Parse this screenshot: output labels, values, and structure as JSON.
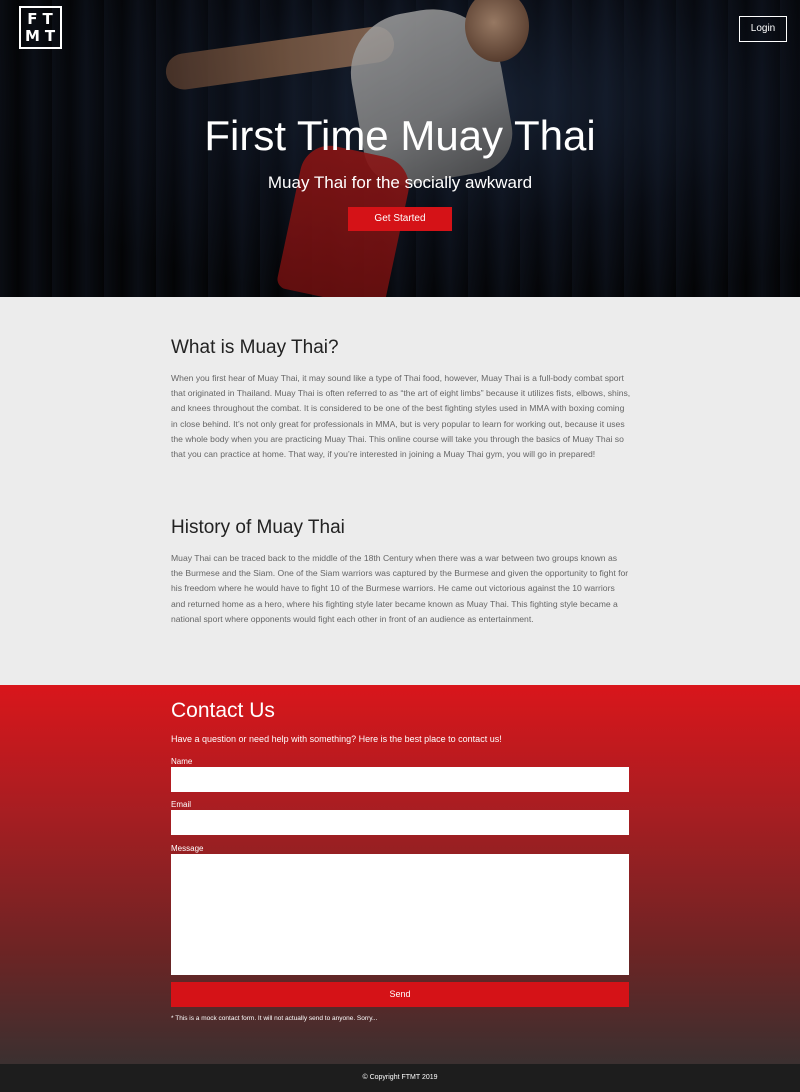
{
  "logo": {
    "line1": "FT",
    "line2": "MT"
  },
  "header": {
    "login_label": "Login"
  },
  "hero": {
    "title": "First Time Muay Thai",
    "subtitle": "Muay Thai for the socially awkward",
    "cta_label": "Get Started"
  },
  "sections": [
    {
      "title": "What is Muay Thai?",
      "body": "When you first hear of Muay Thai, it may sound like a type of Thai food, however, Muay Thai is a full-body combat sport that originated in Thailand. Muay Thai is often referred to as “the art of eight limbs” because it utilizes fists, elbows, shins, and knees throughout the combat. It is considered to be one of the best fighting styles used in MMA with boxing coming in close behind. It’s not only great for professionals in MMA, but is very popular to learn for working out, because it uses the whole body when you are practicing Muay Thai. This online course will take you through the basics of Muay Thai so that you can practice at home. That way, if you’re interested in joining a Muay Thai gym, you will go in prepared!"
    },
    {
      "title": "History of Muay Thai",
      "body": "Muay Thai can be traced back to the middle of the 18th Century when there was a war between two groups known as the Burmese and the Siam. One of the Siam warriors was captured by the Burmese and given the opportunity to fight for his freedom where he would have to fight 10 of the Burmese warriors. He came out victorious against the 10 warriors and returned home as a hero, where his fighting style later became known as Muay Thai. This fighting style became a national sport where opponents would fight each other in front of an audience as entertainment."
    }
  ],
  "contact": {
    "title": "Contact Us",
    "intro": "Have a question or need help with something? Here is the best place to contact us!",
    "name_label": "Name",
    "name_value": "",
    "email_label": "Email",
    "email_value": "",
    "message_label": "Message",
    "message_value": "",
    "send_label": "Send",
    "disclaimer": "* This is a mock contact form. It will not actually send to anyone. Sorry..."
  },
  "footer": {
    "copyright": "© Copyright FTMT 2019"
  },
  "colors": {
    "accent": "#d51217",
    "footer_bg": "#1d1d1d",
    "content_bg": "#ececec"
  }
}
